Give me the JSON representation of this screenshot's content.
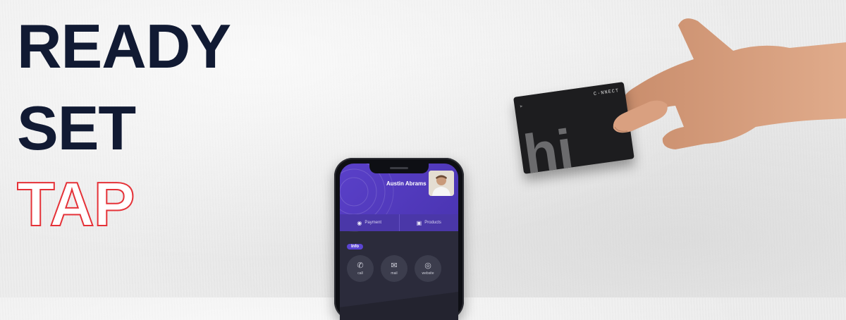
{
  "headline": {
    "line1": "READY",
    "line2": "SET",
    "line3": "TAP"
  },
  "colors": {
    "navy": "#111a33",
    "red_outline": "#e53238",
    "profile_purple": "#5a40c9",
    "card_black": "#1d1d1f"
  },
  "phone": {
    "profile_name": "Austin Abrams",
    "tabs": [
      {
        "icon": "money-bag-icon",
        "label": "Payment"
      },
      {
        "icon": "gift-box-icon",
        "label": "Products"
      }
    ],
    "info_section_label": "Info",
    "info_items": [
      {
        "icon": "phone-icon",
        "label": "call"
      },
      {
        "icon": "mail-icon",
        "label": "mail"
      },
      {
        "icon": "globe-icon",
        "label": "website"
      }
    ]
  },
  "card": {
    "brand": "C·NNECT",
    "big_text": "hi"
  }
}
